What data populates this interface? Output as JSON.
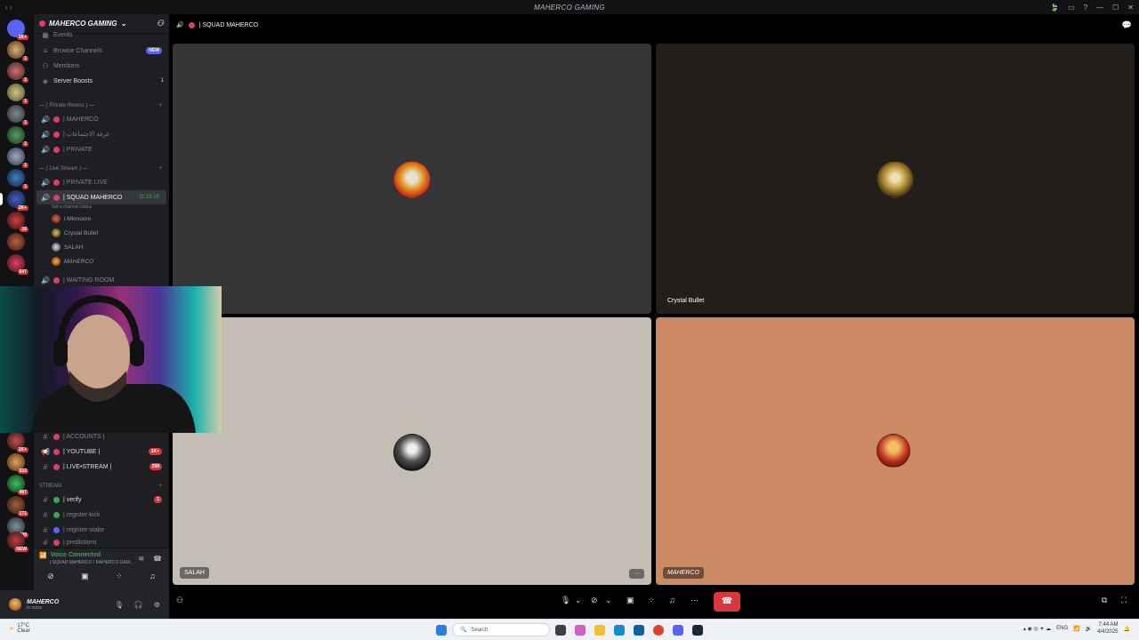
{
  "window": {
    "title": "MAHERCO GAMING",
    "nav": "‹ ›"
  },
  "server": {
    "name": "MAHERCO GAMING"
  },
  "guild_badges": [
    "1K+",
    "1",
    "1",
    "1",
    "1",
    "1",
    "1",
    "2K+",
    "16",
    "647",
    "1K+",
    "532",
    "487",
    "171",
    "809",
    "NEW"
  ],
  "sidebar": {
    "events_label": "Events",
    "browse_channels": "Browse Channels",
    "browse_badge": "NEW",
    "members": "Members",
    "server_boosts": "Server Boosts",
    "server_boosts_count": "1",
    "cat_private": "— ( Private Rooms ) —",
    "ch_maherco": "| MAHERCO",
    "ch_meetings": "| غرفة الاجتماعات",
    "ch_private": "| PRIVATE",
    "cat_live": "— ( Live Stream ) —",
    "ch_private_live": "| PRIVATE LIVE",
    "ch_squad": "| SQUAD MAHERCO",
    "ch_squad_timer": "11:19:19",
    "set_status": "Set a channel status",
    "members_in_voice": [
      "i.Mkmooro",
      "Crystal Bullet",
      "SALAH",
      "MAHERCO"
    ],
    "ch_waiting": "| WAITING ROOM",
    "ch_accounts": "| ACCOUNTS |",
    "ch_youtube": "| YOUTUBE |",
    "ch_youtube_badge": "1K+",
    "ch_live_stream": "| LIVE•STREAM |",
    "ch_live_stream_badge": "298",
    "cat_stream": "STREAM",
    "ch_verify": "| verify",
    "ch_verify_badge": "1",
    "ch_register_kick": "| register-kick",
    "ch_register_stake": "| register-stake",
    "ch_predictions": "| predictions"
  },
  "voice": {
    "status": "Voice Connected",
    "location": "| SQUAD MAHERCO / MAHERCO GAM..."
  },
  "user": {
    "name": "MAHERCO",
    "status": "In voice"
  },
  "main": {
    "channel_title": "| SQUAD MAHERCO",
    "tiles": [
      {
        "name": "",
        "bg": "#353436"
      },
      {
        "name": "Crystal Bullet",
        "bg": "#211e1c"
      },
      {
        "name": "SALAH",
        "bg": "#c3bdb4"
      },
      {
        "name": "MAHERCO",
        "bg": "#cb8a63"
      }
    ],
    "more_label": "···"
  },
  "colors": {
    "accent_red": "#da373c",
    "voice_green": "#3ba55d",
    "channel_dot": "#dc3e6a"
  },
  "taskbar": {
    "temp": "17°C",
    "weather": "Clear",
    "search": "Search",
    "lang": "ENG",
    "time": "7:44 AM",
    "date": "4/4/2025"
  }
}
